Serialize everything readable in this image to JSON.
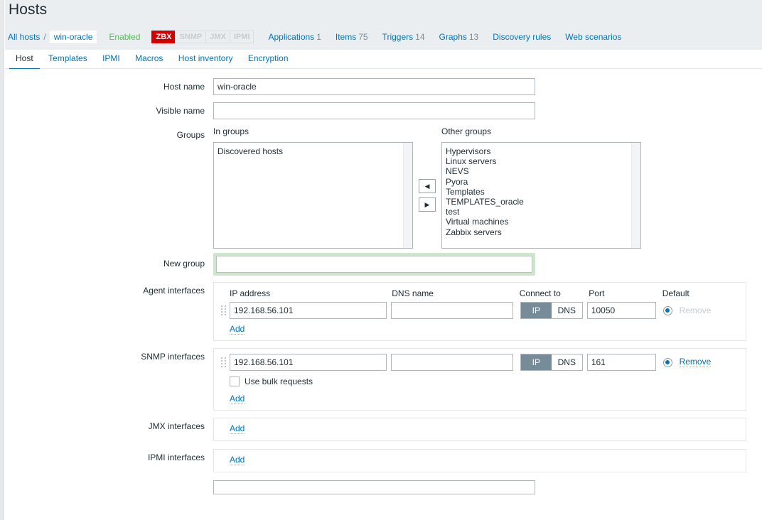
{
  "page": {
    "title": "Hosts"
  },
  "breadcrumb": {
    "all_hosts": "All hosts",
    "separator": "/",
    "current_host": "win-oracle",
    "status": "Enabled",
    "badges": [
      {
        "label": "ZBX",
        "state": "on"
      },
      {
        "label": "SNMP",
        "state": "off"
      },
      {
        "label": "JMX",
        "state": "off"
      },
      {
        "label": "IPMI",
        "state": "off"
      }
    ],
    "meta": [
      {
        "label": "Applications",
        "count": "1"
      },
      {
        "label": "Items",
        "count": "75"
      },
      {
        "label": "Triggers",
        "count": "14"
      },
      {
        "label": "Graphs",
        "count": "13"
      },
      {
        "label": "Discovery rules",
        "count": ""
      },
      {
        "label": "Web scenarios",
        "count": ""
      }
    ]
  },
  "tabs": [
    {
      "label": "Host",
      "active": true
    },
    {
      "label": "Templates",
      "active": false
    },
    {
      "label": "IPMI",
      "active": false
    },
    {
      "label": "Macros",
      "active": false
    },
    {
      "label": "Host inventory",
      "active": false
    },
    {
      "label": "Encryption",
      "active": false
    }
  ],
  "form": {
    "host_name": {
      "label": "Host name",
      "value": "win-oracle",
      "placeholder": ""
    },
    "visible_name": {
      "label": "Visible name",
      "value": "",
      "placeholder": ""
    },
    "groups": {
      "label": "Groups",
      "in_groups_header": "In groups",
      "other_groups_header": "Other groups",
      "in_groups": [
        "Discovered hosts"
      ],
      "other_groups": [
        "Hypervisors",
        "Linux servers",
        "NEVS",
        "Pyora",
        "Templates",
        "TEMPLATES_oracle",
        "test",
        "Virtual machines",
        "Zabbix servers"
      ],
      "move_left_icon": "◀",
      "move_right_icon": "▶"
    },
    "new_group": {
      "label": "New group",
      "value": "",
      "placeholder": ""
    },
    "interface_columns": {
      "ip": "IP address",
      "dns": "DNS name",
      "connect_to": "Connect to",
      "port": "Port",
      "default": "Default"
    },
    "agent_interfaces": {
      "label": "Agent interfaces",
      "rows": [
        {
          "ip": "192.168.56.101",
          "dns": "",
          "connect_ip": "IP",
          "connect_dns": "DNS",
          "connect_selected": "IP",
          "port": "10050",
          "default_selected": true,
          "remove_label": "Remove",
          "remove_enabled": false
        }
      ],
      "add_label": "Add"
    },
    "snmp_interfaces": {
      "label": "SNMP interfaces",
      "rows": [
        {
          "ip": "192.168.56.101",
          "dns": "",
          "connect_ip": "IP",
          "connect_dns": "DNS",
          "connect_selected": "IP",
          "port": "161",
          "default_selected": true,
          "remove_label": "Remove",
          "remove_enabled": true
        }
      ],
      "bulk_label": "Use bulk requests",
      "bulk_checked": false,
      "add_label": "Add"
    },
    "jmx_interfaces": {
      "label": "JMX interfaces",
      "add_label": "Add"
    },
    "ipmi_interfaces": {
      "label": "IPMI interfaces",
      "add_label": "Add"
    }
  },
  "colors": {
    "accent": "#0275b8",
    "header_bg": "#ebeef0",
    "status_enabled": "#59bb59",
    "badge_on": "#d40000",
    "badge_off_text": "#c6ccd1",
    "focus_ring": "#cfe6cd",
    "toggle_selected": "#768d99"
  }
}
